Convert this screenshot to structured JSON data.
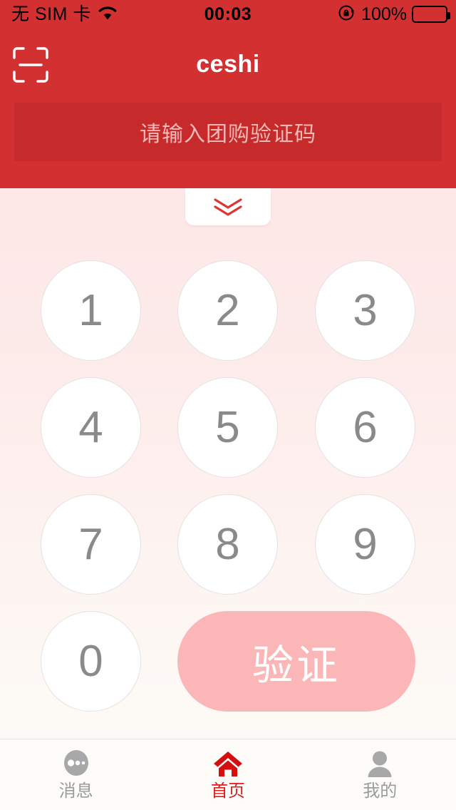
{
  "status_bar": {
    "carrier": "无 SIM 卡",
    "wifi_icon": "wifi-icon",
    "time": "00:03",
    "rotation_lock_icon": "rotation-lock-icon",
    "battery_percent": "100%",
    "battery_icon": "battery-full-icon"
  },
  "nav_bar": {
    "title": "ceshi",
    "scan_icon": "scan-qr-icon"
  },
  "code_input": {
    "value": "",
    "placeholder": "请输入团购验证码"
  },
  "keypad": {
    "collapse_icon": "chevron-double-down-icon",
    "rows": [
      [
        "1",
        "2",
        "3"
      ],
      [
        "4",
        "5",
        "6"
      ],
      [
        "7",
        "8",
        "9"
      ]
    ],
    "zero_key": "0",
    "verify_label": "验证"
  },
  "tab_bar": {
    "tabs": [
      {
        "label": "消息",
        "icon": "message-dots-icon",
        "active": false
      },
      {
        "label": "首页",
        "icon": "home-icon",
        "active": true
      },
      {
        "label": "我的",
        "icon": "person-icon",
        "active": false
      }
    ]
  },
  "colors": {
    "header_red": "#d33131",
    "input_red": "#c62a2a",
    "accent_red": "#d62121",
    "verify_pink": "#fbb7b7",
    "key_text_gray": "#8a8a8a",
    "tab_inactive_gray": "#9b9b9b"
  }
}
